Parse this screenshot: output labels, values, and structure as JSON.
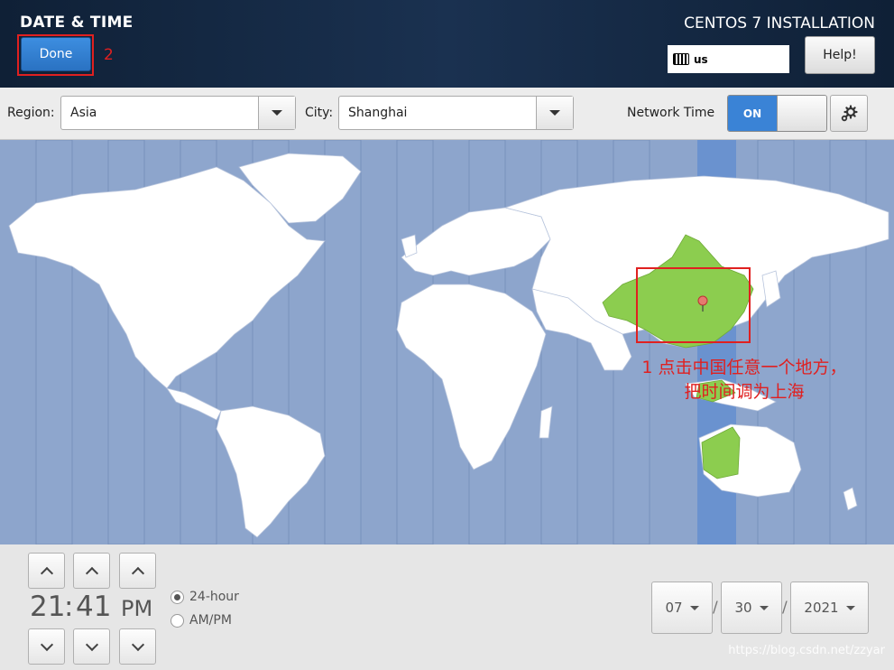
{
  "header": {
    "title": "DATE & TIME",
    "done_label": "Done",
    "step_marker": "2",
    "install_title": "CENTOS 7 INSTALLATION",
    "keyboard_layout": "us",
    "help_label": "Help!"
  },
  "toolbar": {
    "region_label": "Region:",
    "region_value": "Asia",
    "city_label": "City:",
    "city_value": "Shanghai",
    "network_time_label": "Network Time",
    "network_time_state": "ON"
  },
  "map": {
    "selected_timezone_color": "#6a92cf",
    "highlight_color": "#8ccd4f",
    "land_color": "#ffffff",
    "ocean_color": "#8da5cc",
    "annotation_line1": "1 点击中国任意一个地方，",
    "annotation_line2": "把时间调为上海"
  },
  "time": {
    "hours": "21",
    "separator": ":",
    "minutes": "41",
    "ampm": "PM",
    "format_24": "24-hour",
    "format_ampm": "AM/PM",
    "selected_format": "24-hour"
  },
  "date": {
    "month": "07",
    "day": "30",
    "year": "2021",
    "separator": "/"
  },
  "watermark": "https://blog.csdn.net/zzyar"
}
